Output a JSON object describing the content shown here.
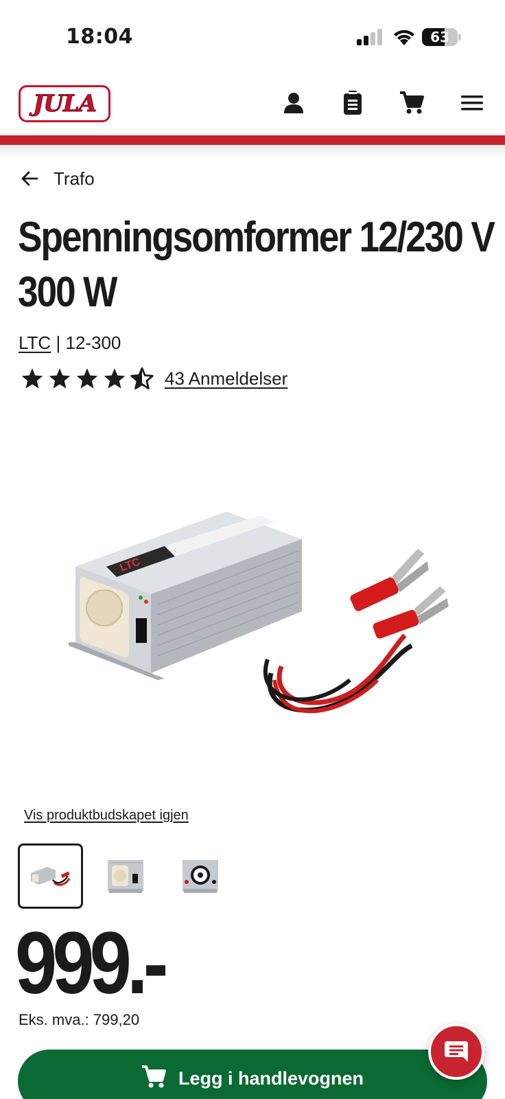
{
  "status_bar": {
    "time": "18:04",
    "battery_percent": "63",
    "battery_level": 0.63
  },
  "header": {
    "logo_text": "JULA",
    "icons": [
      "account-icon",
      "clipboard-list-icon",
      "cart-icon",
      "menu-icon"
    ],
    "accent_color": "#c8242f"
  },
  "breadcrumb": {
    "label": "Trafo"
  },
  "product": {
    "title": "Spenningsomformer 12/230 V 300 W",
    "brand": "LTC",
    "separator": "|",
    "sku": "12-300",
    "rating": 4.5,
    "rating_max": 5,
    "reviews_label": "43 Anmeldelser",
    "reveal_link": "Vis produktbudskapet igjen",
    "thumbnails": [
      "inverter-with-cables",
      "inverter-front-socket",
      "inverter-rear-fan"
    ],
    "price": "999.-",
    "ex_vat": "Eks. mva.: 799,20"
  },
  "actions": {
    "add_to_cart": "Legg i handlevognen",
    "button_color": "#0b6a33",
    "chat_icon": "chat-icon"
  }
}
